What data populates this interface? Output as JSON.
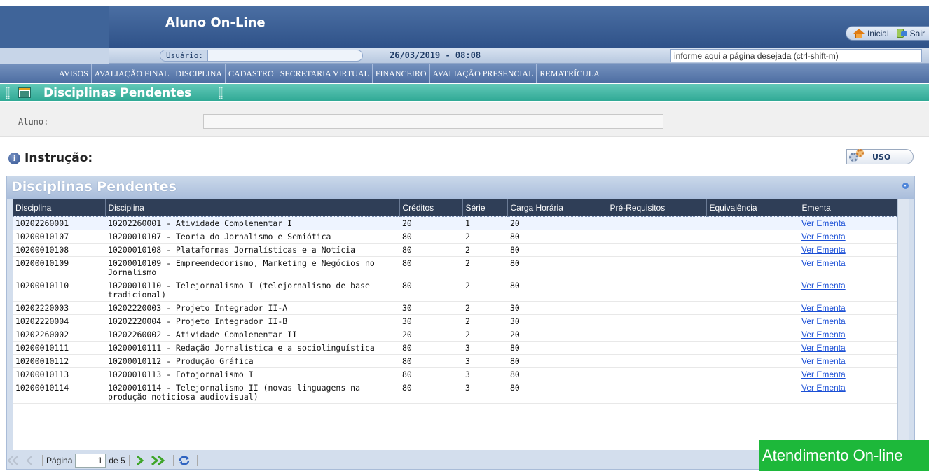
{
  "header": {
    "app_title": "Aluno On-Line",
    "inicial_label": "Inicial",
    "sair_label": "Sair"
  },
  "userbar": {
    "usuario_label": "Usuário:",
    "usuario_value": "",
    "datetime": "26/03/2019 - 08:08",
    "page_search_placeholder": "informe aqui a página desejada (ctrl-shift-m)"
  },
  "menu": {
    "items": [
      "AVISOS",
      "AVALIAÇÃO FINAL",
      "DISCIPLINA",
      "CADASTRO",
      "SECRETARIA VIRTUAL",
      "FINANCEIRO",
      "AVALIAÇÃO PRESENCIAL",
      "REMATRÍCULA"
    ]
  },
  "section": {
    "title": "Disciplinas Pendentes"
  },
  "aluno": {
    "label": "Aluno:",
    "value": ""
  },
  "instrucao": {
    "title": "Instrução:",
    "uso_label": "USO"
  },
  "grid": {
    "title": "Disciplinas Pendentes",
    "columns": [
      "Disciplina",
      "Disciplina",
      "Créditos",
      "Série",
      "Carga Horária",
      "Pré-Requisitos",
      "Equivalência",
      "Ementa"
    ],
    "rows": [
      {
        "code": "10202260001",
        "name": "10202260001 - Atividade Complementar I",
        "creditos": "20",
        "serie": "1",
        "carga": "20",
        "prereq": "",
        "equiv": "",
        "ementa": "Ver Ementa"
      },
      {
        "code": "10200010107",
        "name": "10200010107 - Teoria do Jornalismo e Semiótica",
        "creditos": "80",
        "serie": "2",
        "carga": "80",
        "prereq": "",
        "equiv": "",
        "ementa": "Ver Ementa"
      },
      {
        "code": "10200010108",
        "name": "10200010108 - Plataformas Jornalísticas e a Notícia",
        "creditos": "80",
        "serie": "2",
        "carga": "80",
        "prereq": "",
        "equiv": "",
        "ementa": "Ver Ementa"
      },
      {
        "code": "10200010109",
        "name": "10200010109 - Empreendedorismo, Marketing e Negócios no Jornalismo",
        "creditos": "80",
        "serie": "2",
        "carga": "80",
        "prereq": "",
        "equiv": "",
        "ementa": "Ver Ementa"
      },
      {
        "code": "10200010110",
        "name": "10200010110 - Telejornalismo I (telejornalismo de base tradicional)",
        "creditos": "80",
        "serie": "2",
        "carga": "80",
        "prereq": "",
        "equiv": "",
        "ementa": "Ver Ementa"
      },
      {
        "code": "10202220003",
        "name": "10202220003 - Projeto Integrador II-A",
        "creditos": "30",
        "serie": "2",
        "carga": "30",
        "prereq": "",
        "equiv": "",
        "ementa": "Ver Ementa"
      },
      {
        "code": "10202220004",
        "name": "10202220004 - Projeto Integrador II-B",
        "creditos": "30",
        "serie": "2",
        "carga": "30",
        "prereq": "",
        "equiv": "",
        "ementa": "Ver Ementa"
      },
      {
        "code": "10202260002",
        "name": "10202260002 - Atividade Complementar II",
        "creditos": "20",
        "serie": "2",
        "carga": "20",
        "prereq": "",
        "equiv": "",
        "ementa": "Ver Ementa"
      },
      {
        "code": "10200010111",
        "name": "10200010111 - Redação Jornalística e a sociolinguística",
        "creditos": "80",
        "serie": "3",
        "carga": "80",
        "prereq": "",
        "equiv": "",
        "ementa": "Ver Ementa"
      },
      {
        "code": "10200010112",
        "name": "10200010112 - Produção Gráfica",
        "creditos": "80",
        "serie": "3",
        "carga": "80",
        "prereq": "",
        "equiv": "",
        "ementa": "Ver Ementa"
      },
      {
        "code": "10200010113",
        "name": "10200010113 - Fotojornalismo I",
        "creditos": "80",
        "serie": "3",
        "carga": "80",
        "prereq": "",
        "equiv": "",
        "ementa": "Ver Ementa"
      },
      {
        "code": "10200010114",
        "name": "10200010114 - Telejornalismo II (novas linguagens na produção noticiosa audiovisual)",
        "creditos": "80",
        "serie": "3",
        "carga": "80",
        "prereq": "",
        "equiv": "",
        "ementa": "Ver Ementa"
      }
    ]
  },
  "pager": {
    "page_label": "Página",
    "page_value": "1",
    "of_label": "de 5"
  },
  "chat": {
    "label": "Atendimento On-line"
  },
  "colors": {
    "header": "#2f5289",
    "section": "#2ea894",
    "grid_header": "#2f3e57",
    "link": "#1a4fd6",
    "chat": "#1db83a"
  }
}
